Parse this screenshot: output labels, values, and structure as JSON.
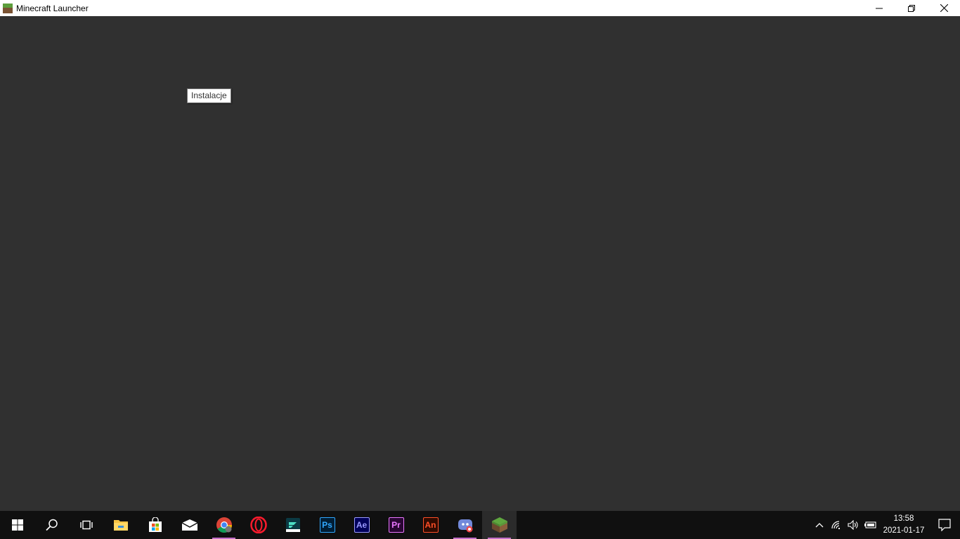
{
  "window": {
    "title": "Minecraft Launcher",
    "icon": "minecraft-grass-block-icon",
    "controls": {
      "minimize": "minimize-icon",
      "restore": "restore-icon",
      "close": "close-icon"
    }
  },
  "tooltip": {
    "text": "Instalacje"
  },
  "taskbar": {
    "items": [
      {
        "name": "start",
        "icon": "windows-logo-icon"
      },
      {
        "name": "search",
        "icon": "search-icon"
      },
      {
        "name": "task-view",
        "icon": "task-view-icon"
      },
      {
        "name": "file-explorer",
        "icon": "folder-icon"
      },
      {
        "name": "microsoft-store",
        "icon": "store-bag-icon"
      },
      {
        "name": "mail",
        "icon": "mail-envelope-icon"
      },
      {
        "name": "chrome",
        "icon": "chrome-icon",
        "running": true
      },
      {
        "name": "opera",
        "icon": "opera-icon"
      },
      {
        "name": "filmora",
        "icon": "filmora-icon"
      },
      {
        "name": "photoshop",
        "label": "Ps",
        "color": "#31a8ff",
        "bg": "#001e36"
      },
      {
        "name": "after-effects",
        "label": "Ae",
        "color": "#9999ff",
        "bg": "#00005b"
      },
      {
        "name": "premiere-pro",
        "label": "Pr",
        "color": "#ea77ff",
        "bg": "#2a0634"
      },
      {
        "name": "animate",
        "label": "An",
        "color": "#ff4f28",
        "bg": "#300a00"
      },
      {
        "name": "discord",
        "icon": "discord-icon",
        "running": true
      },
      {
        "name": "minecraft",
        "icon": "minecraft-grass-block-icon",
        "running": true,
        "active": true
      }
    ],
    "tray": {
      "icons": [
        "chevron-up-icon",
        "network-icon",
        "volume-icon",
        "battery-icon"
      ],
      "time": "13:58",
      "date": "2021-01-17",
      "notification_icon": "notification-icon"
    }
  },
  "colors": {
    "content_bg": "#303030",
    "taskbar_bg": "#101010",
    "running_indicator": "#c46fc9"
  }
}
